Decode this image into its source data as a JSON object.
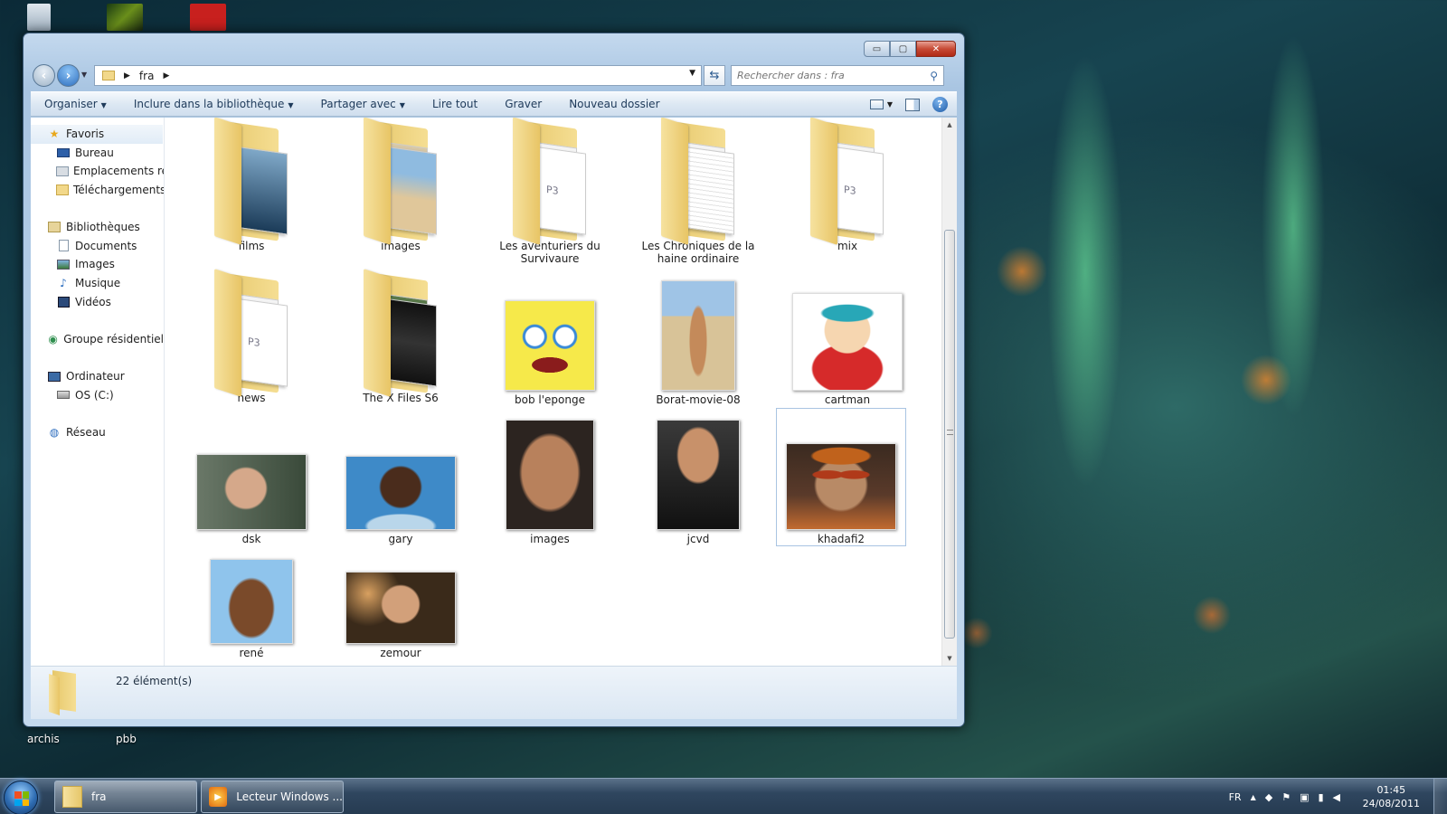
{
  "window": {
    "address_path": "fra",
    "search_placeholder": "Rechercher dans : fra",
    "caption": {
      "minimize": "▭",
      "maximize": "▢",
      "close": "✕"
    }
  },
  "toolbar": {
    "organize": "Organiser",
    "include_library": "Inclure dans la bibliothèque",
    "share_with": "Partager avec",
    "play_all": "Lire tout",
    "burn": "Graver",
    "new_folder": "Nouveau dossier",
    "help": "?"
  },
  "sidebar": {
    "favorites": "Favoris",
    "desktop": "Bureau",
    "recent_places": "Emplacements réc",
    "downloads": "Téléchargements",
    "libraries": "Bibliothèques",
    "documents": "Documents",
    "images": "Images",
    "music": "Musique",
    "videos": "Vidéos",
    "homegroup": "Groupe résidentiel",
    "computer": "Ordinateur",
    "os_drive": "OS (C:)",
    "network": "Réseau"
  },
  "items": [
    {
      "name": "films",
      "kind": "folder"
    },
    {
      "name": "images",
      "kind": "folder"
    },
    {
      "name": "Les aventuriers du Survivaure",
      "kind": "folder"
    },
    {
      "name": "Les Chroniques de la haine ordinaire",
      "kind": "folder"
    },
    {
      "name": "mix",
      "kind": "folder"
    },
    {
      "name": "news",
      "kind": "folder"
    },
    {
      "name": "The X Files S6",
      "kind": "folder"
    },
    {
      "name": "bob l'eponge",
      "kind": "image"
    },
    {
      "name": "Borat-movie-08",
      "kind": "image"
    },
    {
      "name": "cartman",
      "kind": "image"
    },
    {
      "name": "dsk",
      "kind": "image"
    },
    {
      "name": "gary",
      "kind": "image"
    },
    {
      "name": "images",
      "kind": "image"
    },
    {
      "name": "jcvd",
      "kind": "image"
    },
    {
      "name": "khadafi2",
      "kind": "image",
      "selected": true
    },
    {
      "name": "rené",
      "kind": "image"
    },
    {
      "name": "zemour",
      "kind": "image"
    }
  ],
  "folder_badges": {
    "mp3": "P3"
  },
  "status": {
    "count": "22 élément(s)"
  },
  "desktop": {
    "icons": [
      "archis",
      "pbb"
    ]
  },
  "taskbar": {
    "explorer_label": "fra",
    "media_player_label": "Lecteur Windows ...",
    "lang": "FR",
    "time": "01:45",
    "date": "24/08/2011"
  },
  "colors": {
    "folder": "#f2d88a",
    "accent": "#2f6fbf",
    "close": "#c74a35"
  }
}
